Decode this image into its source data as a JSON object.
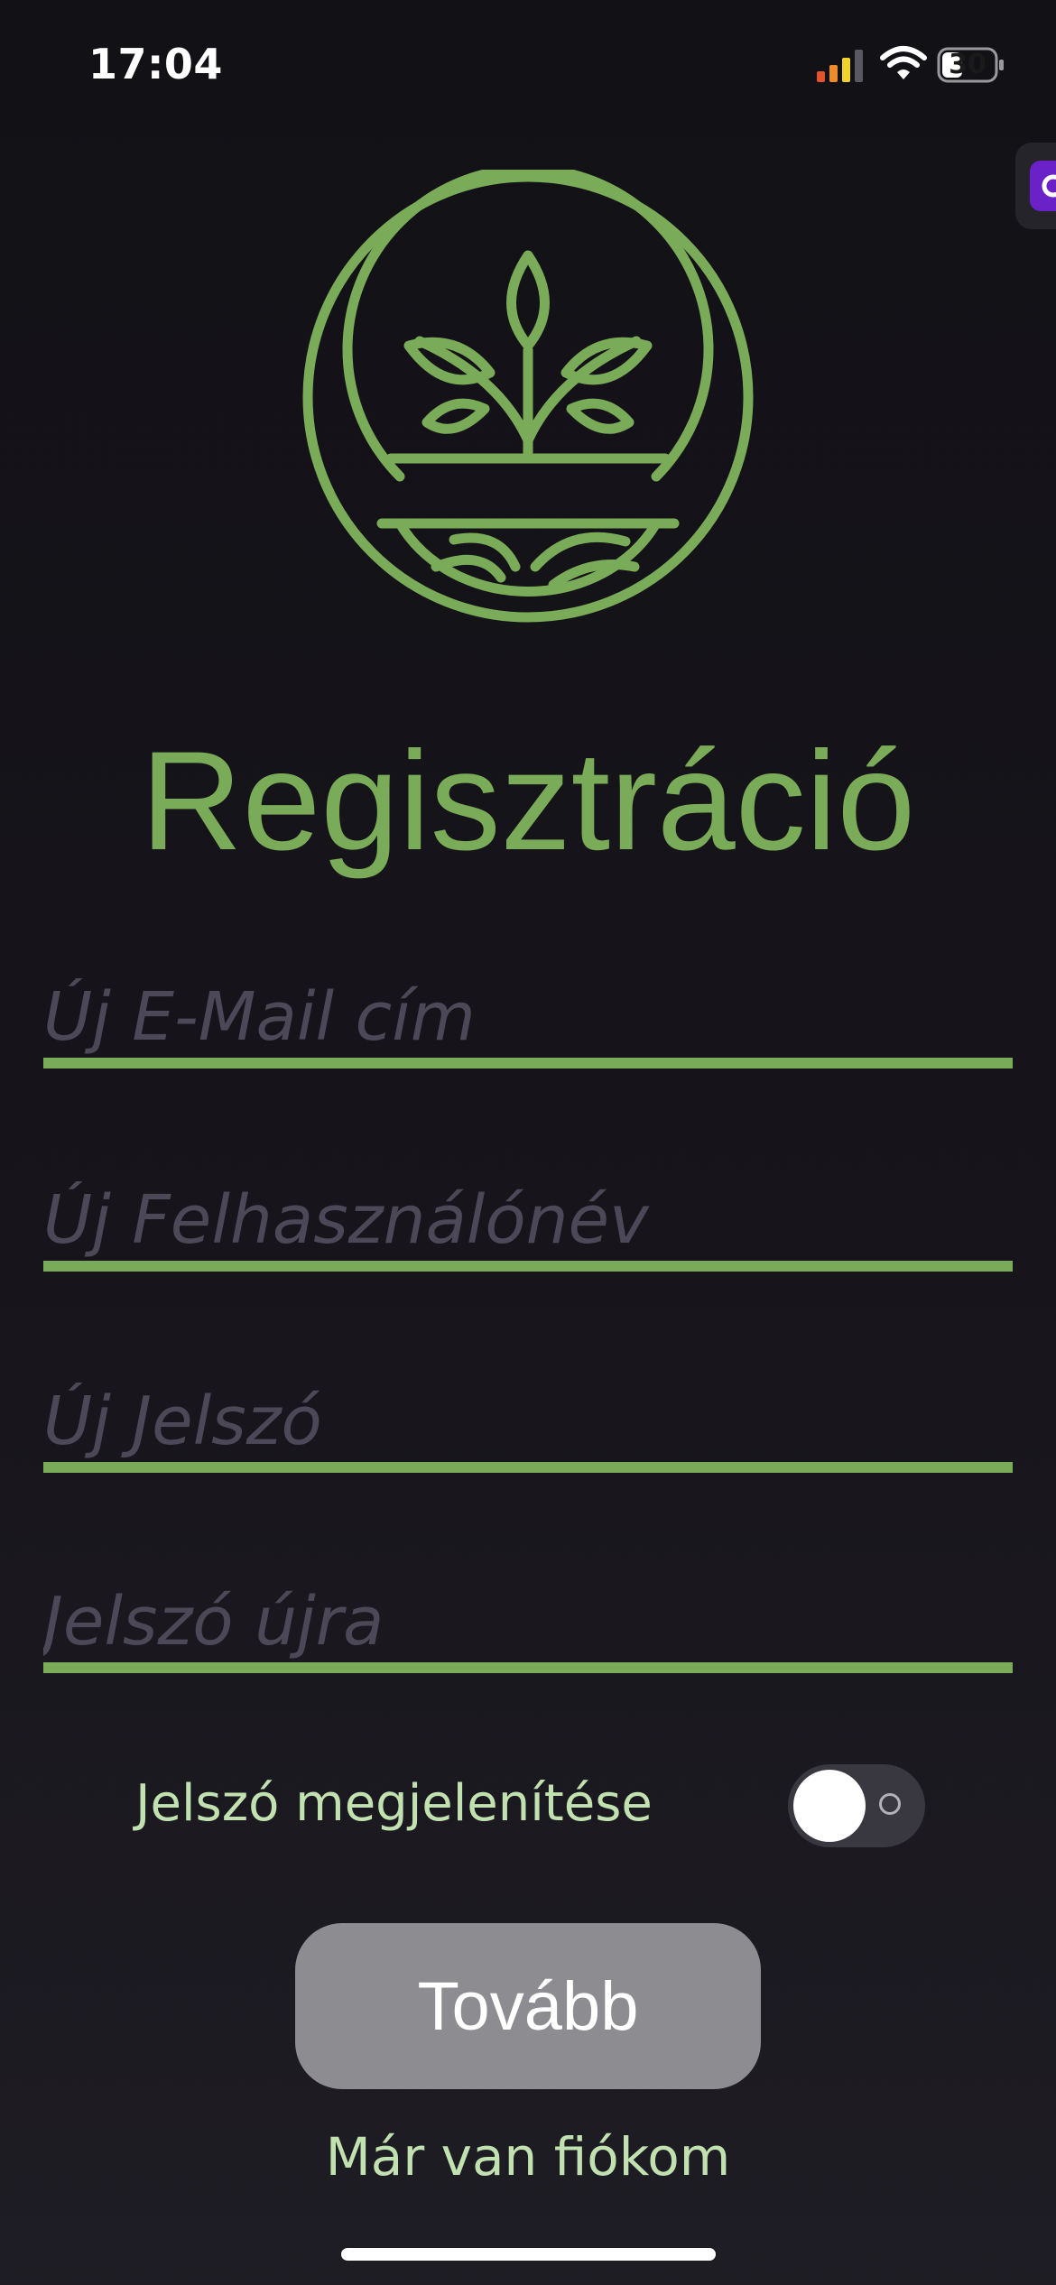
{
  "status_bar": {
    "time": "17:04",
    "battery_level": "30",
    "icons": [
      "cellular-signal-icon",
      "wifi-icon",
      "battery-icon"
    ]
  },
  "side_widget": {
    "icon": "floating-app-icon"
  },
  "logo": {
    "icon": "plant-sprout-logo",
    "color": "#7aab58"
  },
  "title": "Regisztráció",
  "form": {
    "email_placeholder": "Új E-Mail cím",
    "email_value": "",
    "username_placeholder": "Új Felhasználónév",
    "username_value": "",
    "password_placeholder": "Új Jelszó",
    "password_value": "",
    "password_repeat_placeholder": "Jelszó újra",
    "password_repeat_value": ""
  },
  "show_password": {
    "label": "Jelszó megjelenítése",
    "enabled": false
  },
  "continue_label": "Tovább",
  "login_link": "Már van fiókom",
  "colors": {
    "accent": "#7aab58",
    "label_text": "#c2e1b0",
    "placeholder": "#4c4858",
    "button_bg": "#8d8c91",
    "background": "#121116"
  }
}
